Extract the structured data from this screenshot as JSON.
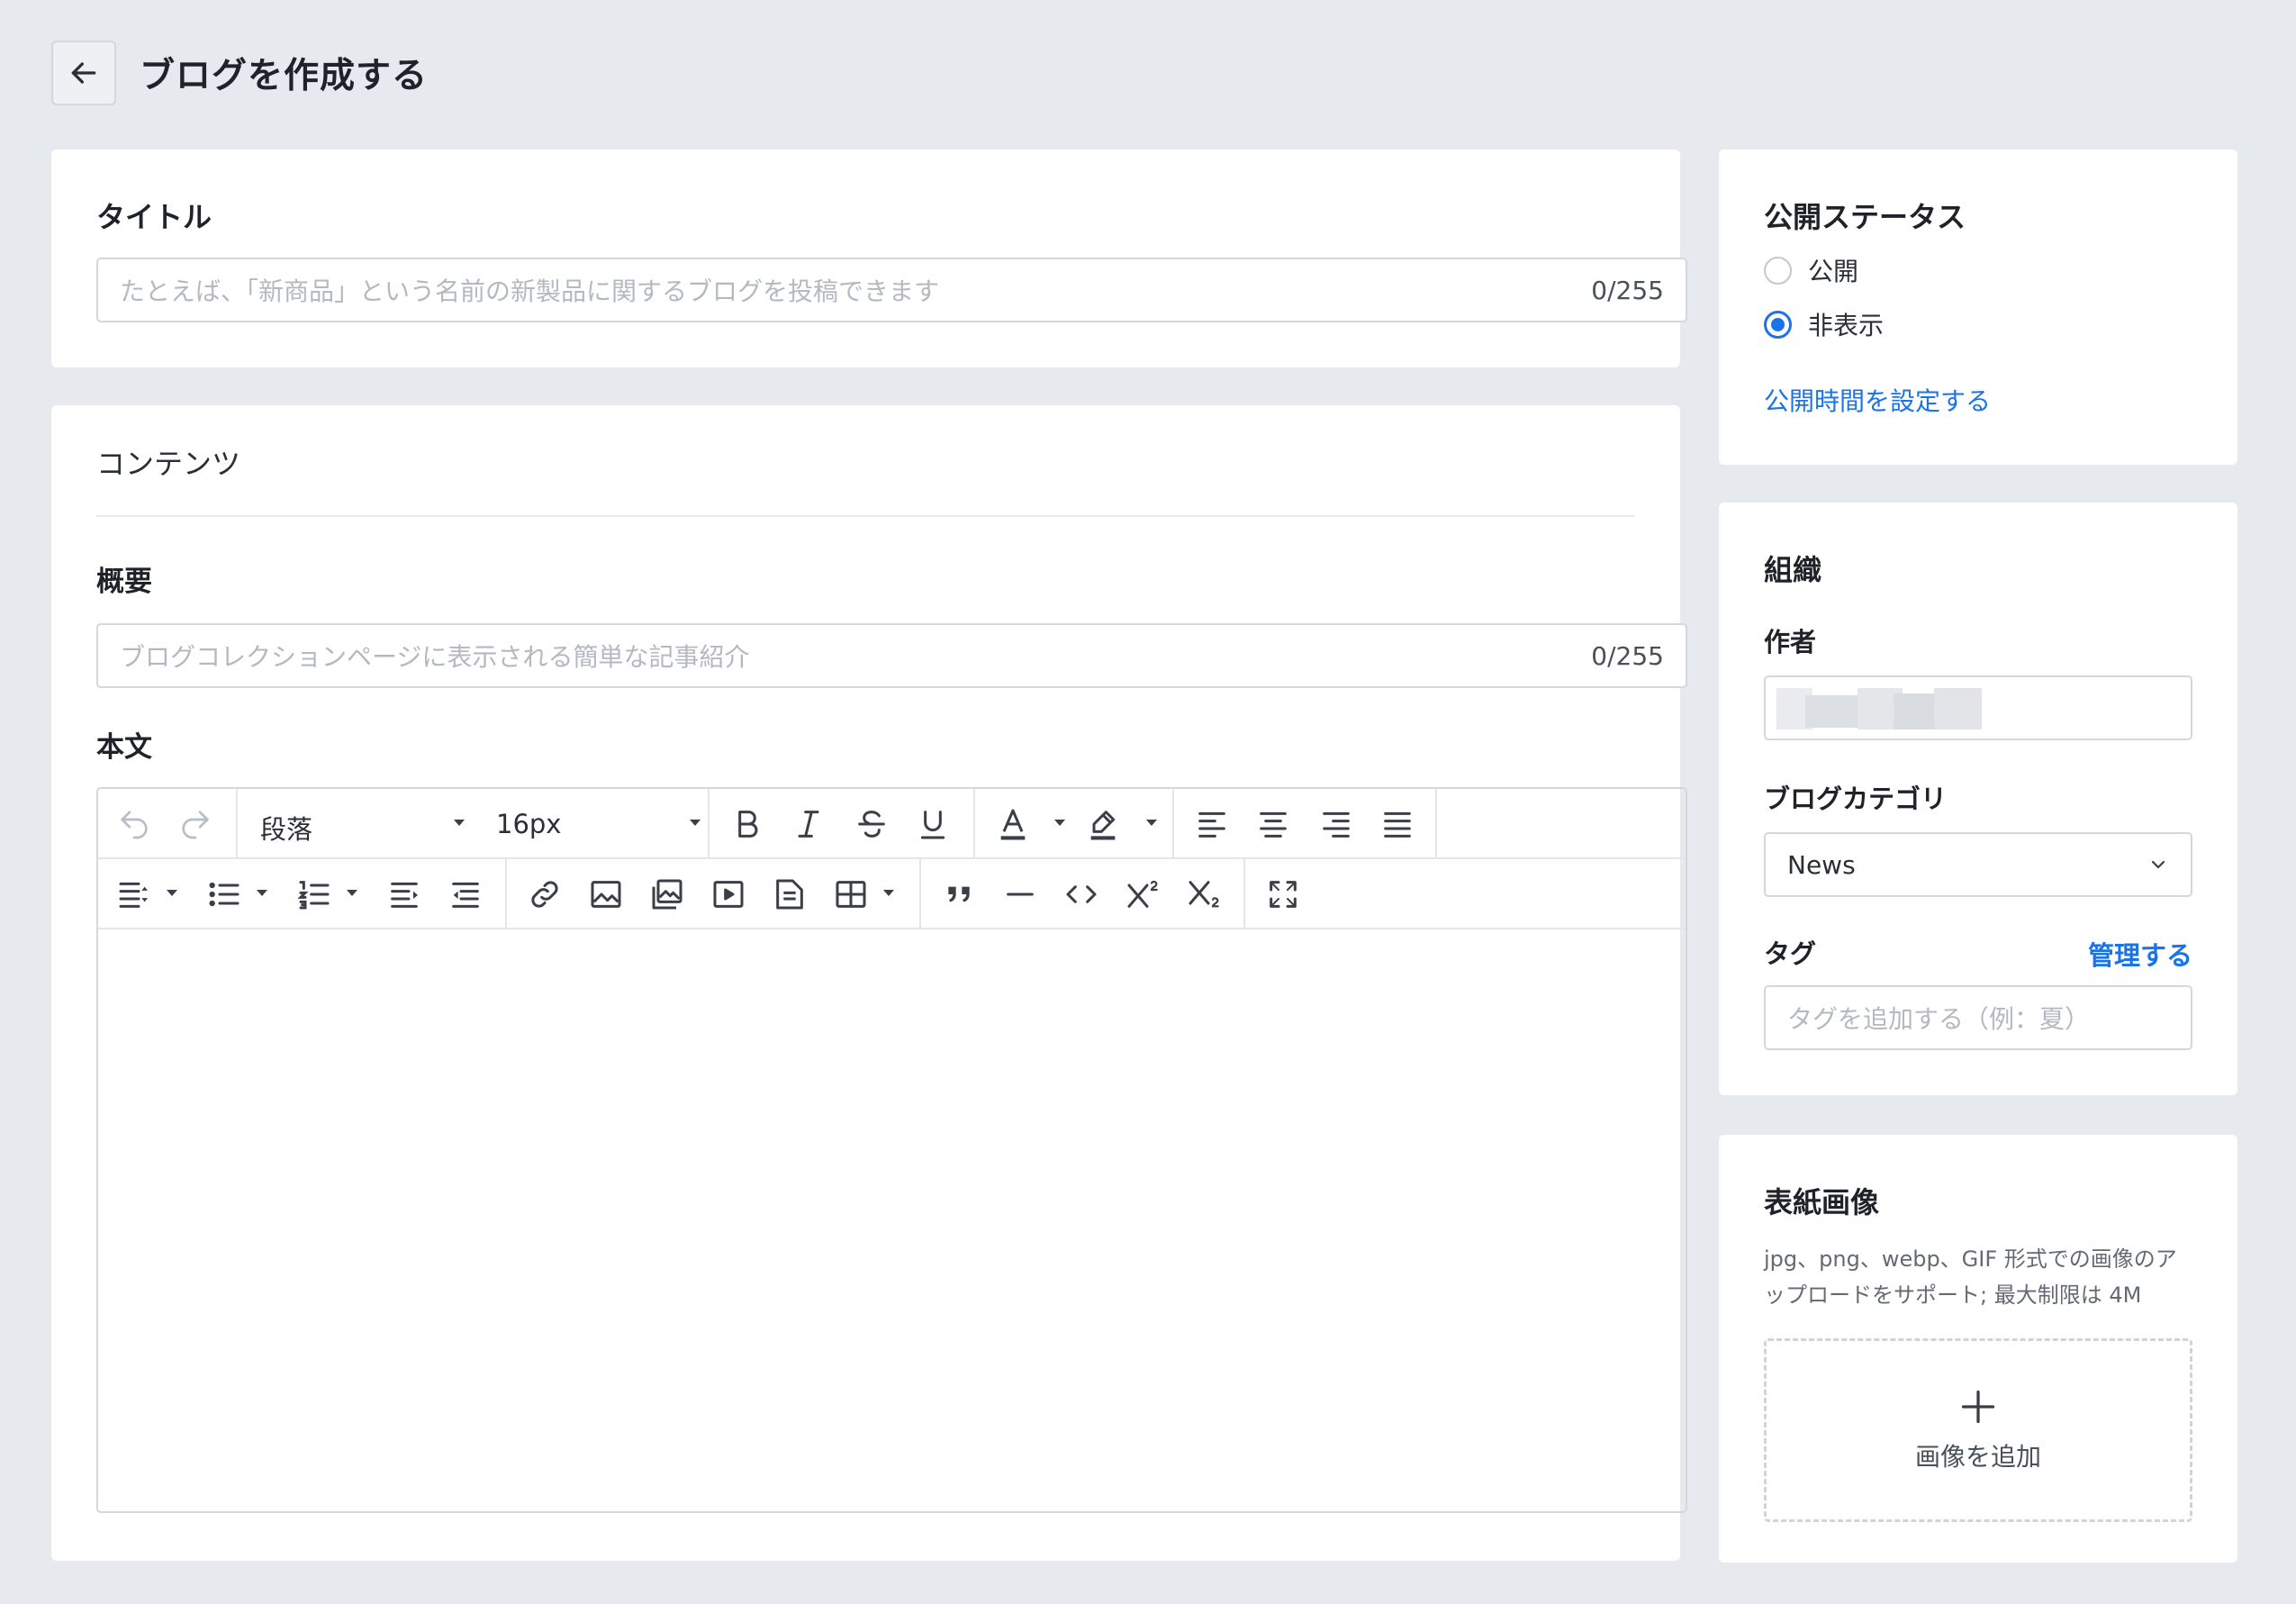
{
  "header": {
    "title": "ブログを作成する"
  },
  "title_card": {
    "label": "タイトル",
    "placeholder": "たとえば、「新商品」という名前の新製品に関するブログを投稿できます",
    "counter": "0/255"
  },
  "content_card": {
    "section_label": "コンテンツ",
    "summary_label": "概要",
    "summary_placeholder": "ブログコレクションページに表示される簡単な記事紹介",
    "summary_counter": "0/255",
    "body_label": "本文",
    "toolbar": {
      "paragraph_select": "段落",
      "font_size_select": "16px"
    }
  },
  "publish_card": {
    "title": "公開ステータス",
    "options": [
      {
        "label": "公開",
        "checked": false
      },
      {
        "label": "非表示",
        "checked": true
      }
    ],
    "schedule_link": "公開時間を設定する"
  },
  "organization_card": {
    "title": "組織",
    "author_label": "作者",
    "category_label": "ブログカテゴリ",
    "category_value": "News",
    "tag_label": "タグ",
    "tag_manage_link": "管理する",
    "tag_placeholder": "タグを追加する（例：夏）"
  },
  "cover_card": {
    "title": "表紙画像",
    "hint": "jpg、png、webp、GIF 形式での画像のアップロードをサポート; 最大制限は 4M",
    "add_image": "画像を追加"
  },
  "colors": {
    "accent": "#1a73e8",
    "background": "#e6e9ee",
    "border": "#d3d7de"
  }
}
